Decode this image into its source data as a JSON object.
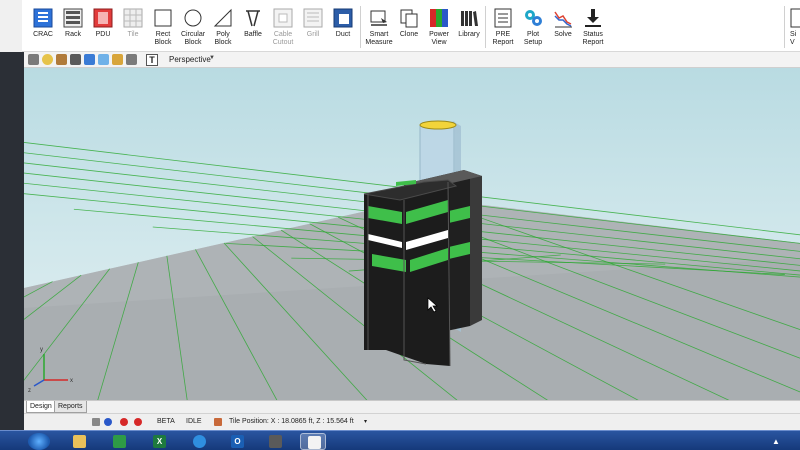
{
  "ribbon": {
    "buttons": [
      {
        "label": "CRAC",
        "icon": "crac-icon",
        "enabled": true
      },
      {
        "label": "Rack",
        "icon": "rack-icon",
        "enabled": true
      },
      {
        "label": "PDU",
        "icon": "pdu-icon",
        "enabled": true
      },
      {
        "label": "Tile",
        "icon": "tile-icon",
        "enabled": false
      },
      {
        "label": "Rect\nBlock",
        "icon": "rect-block-icon",
        "enabled": true
      },
      {
        "label": "Circular\nBlock",
        "icon": "circular-block-icon",
        "enabled": true
      },
      {
        "label": "Poly\nBlock",
        "icon": "poly-block-icon",
        "enabled": true
      },
      {
        "label": "Baffle",
        "icon": "baffle-icon",
        "enabled": true
      },
      {
        "label": "Cable\nCutout",
        "icon": "cable-cutout-icon",
        "enabled": false
      },
      {
        "label": "Grill",
        "icon": "grill-icon",
        "enabled": false
      },
      {
        "label": "Duct",
        "icon": "duct-icon",
        "enabled": true
      },
      {
        "label": "Smart\nMeasure",
        "icon": "smart-measure-icon",
        "enabled": true
      },
      {
        "label": "Clone",
        "icon": "clone-icon",
        "enabled": true
      },
      {
        "label": "Power\nView",
        "icon": "power-view-icon",
        "enabled": true
      },
      {
        "label": "Library",
        "icon": "library-icon",
        "enabled": true
      },
      {
        "label": "PRE\nReport",
        "icon": "pre-report-icon",
        "enabled": true
      },
      {
        "label": "Plot\nSetup",
        "icon": "plot-setup-icon",
        "enabled": true
      },
      {
        "label": "Solve",
        "icon": "solve-icon",
        "enabled": true
      },
      {
        "label": "Status\nReport",
        "icon": "status-report-icon",
        "enabled": true
      },
      {
        "label": "Si\nV",
        "icon": "simulation-view-icon",
        "enabled": true
      }
    ]
  },
  "toolbar2": {
    "text_tool": "T",
    "view_mode": "Perspective"
  },
  "axes": {
    "x": "x",
    "y": "y",
    "z": "z"
  },
  "tabs": {
    "design": "Design",
    "reports": "Reports"
  },
  "status": {
    "beta": "BETA",
    "idle": "IDLE",
    "tile_position": "Tile Position: X : 18.0865 ft, Z : 15.564 ft"
  },
  "taskbar": {
    "excel_label": "X",
    "outlook_label": "O",
    "tray_arrow": "▲"
  },
  "colors": {
    "rack_green": "#3fbf4a",
    "rack_body": "#1c1c1c",
    "grid_line": "#29a82e",
    "floor": "#a9aeb1",
    "sky": "#c4e1e6"
  }
}
